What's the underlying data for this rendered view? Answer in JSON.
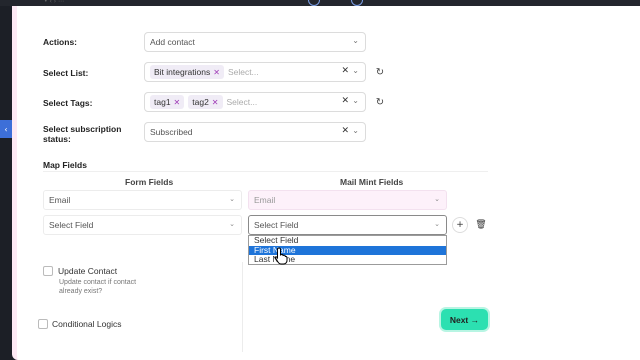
{
  "form": {
    "actions_label": "Actions:",
    "actions_value": "Add contact",
    "list_label": "Select List:",
    "list_chips": [
      "Bit integrations"
    ],
    "list_placeholder": "Select...",
    "tags_label": "Select Tags:",
    "tags_chips": [
      "tag1",
      "tag2"
    ],
    "tags_placeholder": "Select...",
    "status_label_line1": "Select subscription",
    "status_label_line2": "status:",
    "status_value": "Subscribed"
  },
  "map": {
    "title": "Map Fields",
    "col_form": "Form Fields",
    "col_mail": "Mail Mint Fields",
    "row1_form": "Email",
    "row1_mail": "Email",
    "row2_form": "Select Field",
    "row2_mail": "Select Field",
    "dropdown_options": [
      "Select Field",
      "First Name",
      "Last Name"
    ],
    "dropdown_highlighted": "First Name"
  },
  "options": {
    "update_contact_label": "Update Contact",
    "update_contact_hint": "Update contact if contact already exist?",
    "conditional_logics_label": "Conditional Logics"
  },
  "footer": {
    "next_label": "Next →"
  },
  "colors": {
    "accent_next": "#2ce0b1",
    "highlight": "#1e74d9",
    "chip_x": "#a03cb8"
  }
}
